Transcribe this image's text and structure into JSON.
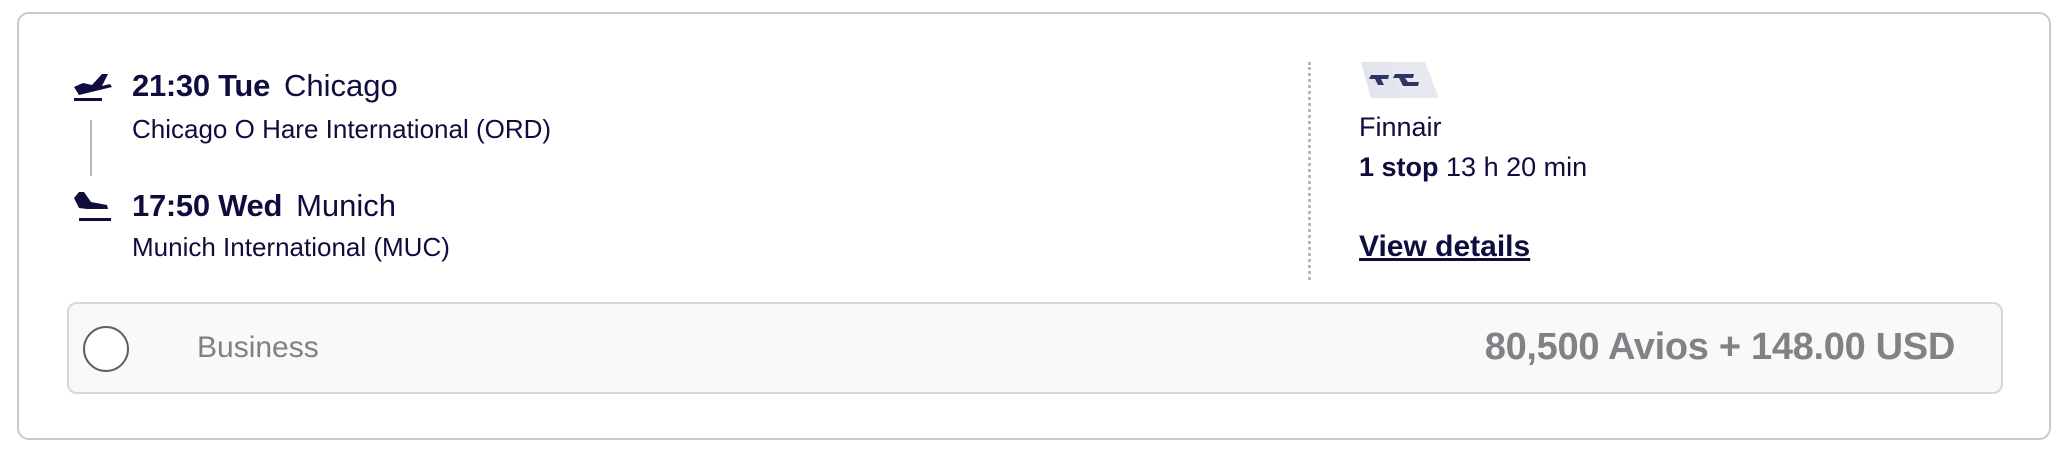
{
  "outbound": {
    "departure": {
      "time": "21:30 Tue",
      "city": "Chicago",
      "airport": "Chicago O Hare International (ORD)"
    },
    "arrival": {
      "time": "17:50 Wed",
      "city": "Munich",
      "airport": "Munich International (MUC)"
    }
  },
  "summary": {
    "airline": "Finnair",
    "stops": "1 stop",
    "duration": "13 h 20 min",
    "details_link": "View details"
  },
  "fare": {
    "cabin": "Business",
    "price": "80,500 Avios + 148.00 USD",
    "selected": false
  },
  "icons": {
    "departure": "takeoff-icon",
    "arrival": "landing-icon",
    "airline_logo": "finnair-logo"
  },
  "colors": {
    "text": "#0f0c3e",
    "border": "#c9c9d2",
    "muted": "#818186",
    "fare_background": "#f9f9f9"
  }
}
